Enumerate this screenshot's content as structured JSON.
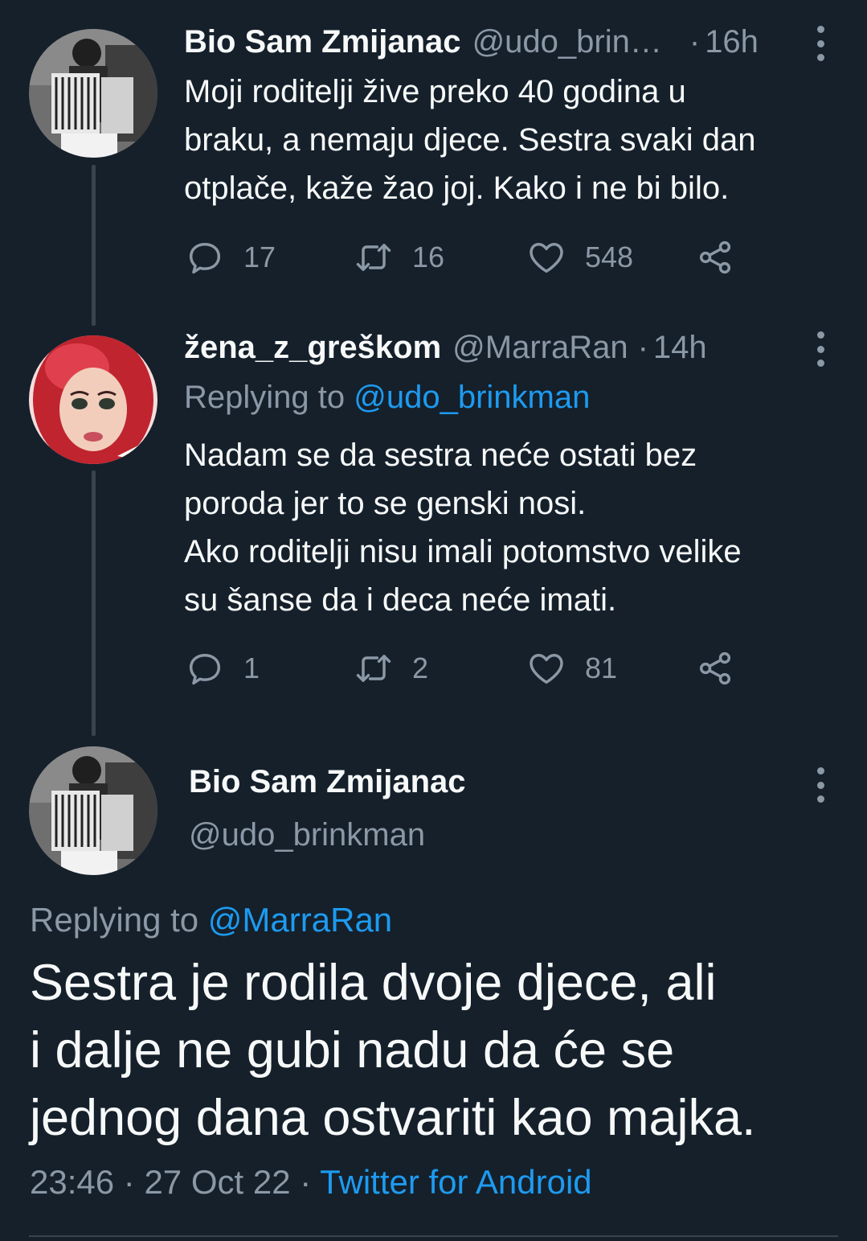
{
  "tweet1": {
    "name": "Bio Sam Zmijanac",
    "handle": "@udo_brin…",
    "separator": "·",
    "time": "16h",
    "text": "Moji roditelji žive preko 40 godina u\nbraku, a nemaju djece. Sestra svaki dan\notplače, kaže žao joj. Kako i ne bi bilo.",
    "replies": "17",
    "retweets": "16",
    "likes": "548"
  },
  "tweet2": {
    "name": "žena_z_greškom",
    "handle": "@MarraRan",
    "separator": "·",
    "time": "14h",
    "replying_label": "Replying to",
    "replying_handle": "@udo_brinkman",
    "text": "Nadam se da sestra neće ostati bez\nporoda jer to se genski nosi.\nAko roditelji nisu imali potomstvo velike\nsu šanse da i deca neće imati.",
    "replies": "1",
    "retweets": "2",
    "likes": "81"
  },
  "main_tweet": {
    "name": "Bio Sam Zmijanac",
    "handle": "@udo_brinkman",
    "replying_label": "Replying to",
    "replying_handle": "@MarraRan",
    "text": "Sestra je rodila dvoje djece, ali\ni dalje ne gubi nadu da će se\njednog dana ostvariti kao majka.",
    "time": "23:46",
    "date": "27 Oct 22",
    "separator": "·",
    "source": "Twitter for Android"
  },
  "colors": {
    "background": "#15202b",
    "text": "#f7f9f9",
    "muted": "#8b98a5",
    "link": "#1d9bf0",
    "line": "#38444d"
  },
  "icons": [
    "reply-icon",
    "retweet-icon",
    "like-icon",
    "share-icon",
    "more-icon"
  ]
}
